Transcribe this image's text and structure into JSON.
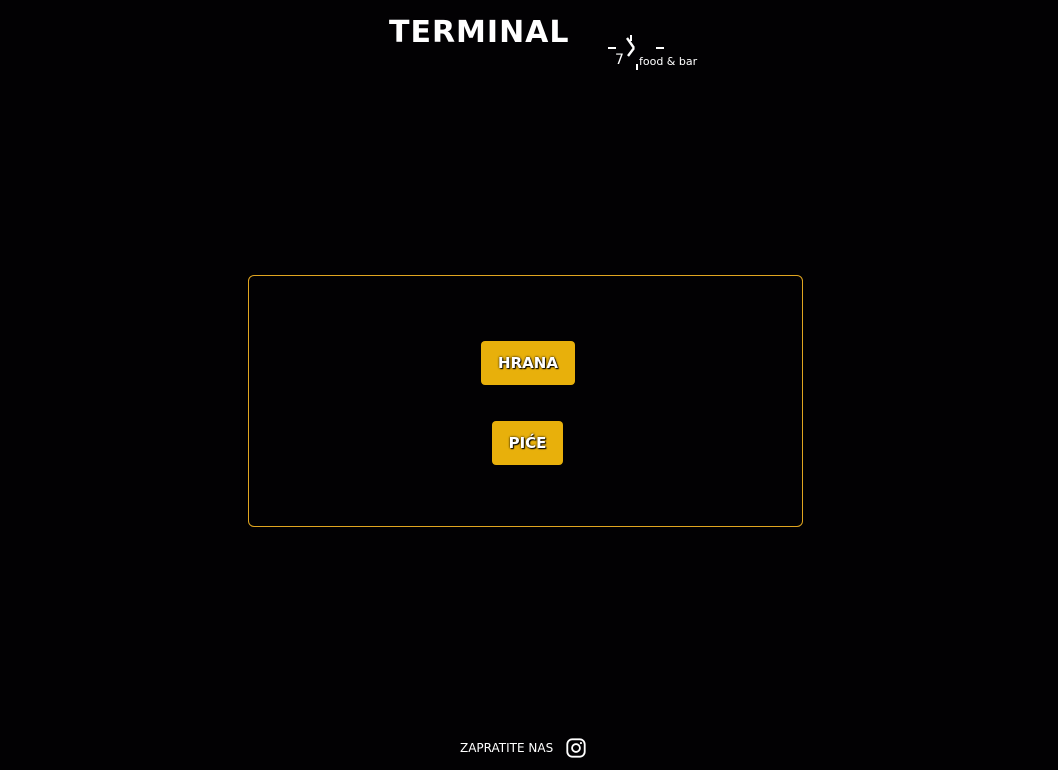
{
  "header": {
    "logo_word": "TERMINAL",
    "logo_number": "7",
    "logo_tagline": "food & bar",
    "logo_icon": "clock-icon"
  },
  "menu": {
    "border_color": "#e0a520",
    "button_color": "#e8b00b",
    "buttons": [
      {
        "label": "HRANA"
      },
      {
        "label": "PIĆE"
      }
    ]
  },
  "footer": {
    "follow_label": "ZAPRATITE NAS",
    "social_icon": "instagram-icon"
  }
}
